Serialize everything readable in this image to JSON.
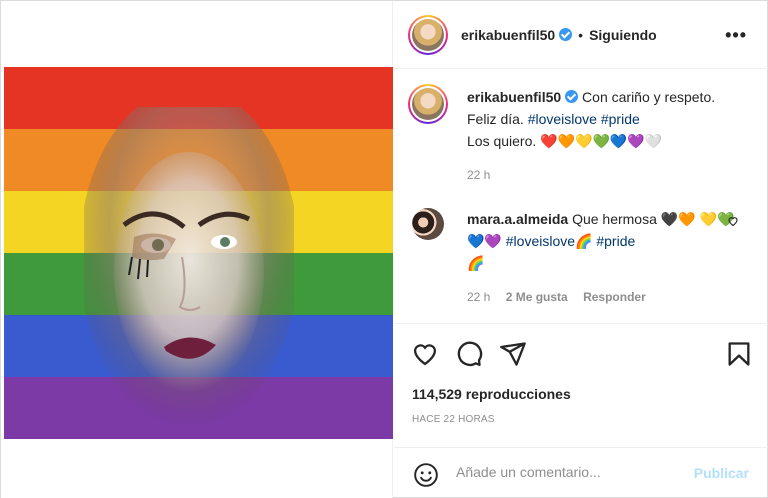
{
  "post": {
    "username": "erikabuenfil50",
    "follow_status": "Siguiendo",
    "separator": "•",
    "more_label": "•••"
  },
  "caption": {
    "username": "erikabuenfil50",
    "text_before_tags": "Con cariño y respeto. Feliz día.",
    "tag1": "#loveislove",
    "tag2": "#pride",
    "text_after": "Los quiero.",
    "hearts": [
      "❤️",
      "🧡",
      "💛",
      "💚",
      "💙",
      "💜",
      "🤍"
    ],
    "time": "22 h"
  },
  "comment": {
    "username": "mara.a.almeida",
    "text": "Que hermosa",
    "emoji_a": "🖤🧡",
    "emoji_b": "💛💚💙💜",
    "tag1": "#loveislove🌈",
    "tag2": "#pride",
    "emoji_c": "🌈",
    "time": "22 h",
    "likes": "2 Me gusta",
    "reply": "Responder"
  },
  "stats": {
    "views": "114,529 reproducciones",
    "posted": "HACE 22 HORAS"
  },
  "composer": {
    "placeholder": "Añade un comentario...",
    "publish_label": "Publicar"
  },
  "colors": {
    "flag": [
      "#e40303",
      "#ff8c00",
      "#ffed00",
      "#008026",
      "#004dff",
      "#750787"
    ],
    "link": "#00376b",
    "verified": "#3897f0",
    "publish_disabled": "#b2dffc"
  }
}
